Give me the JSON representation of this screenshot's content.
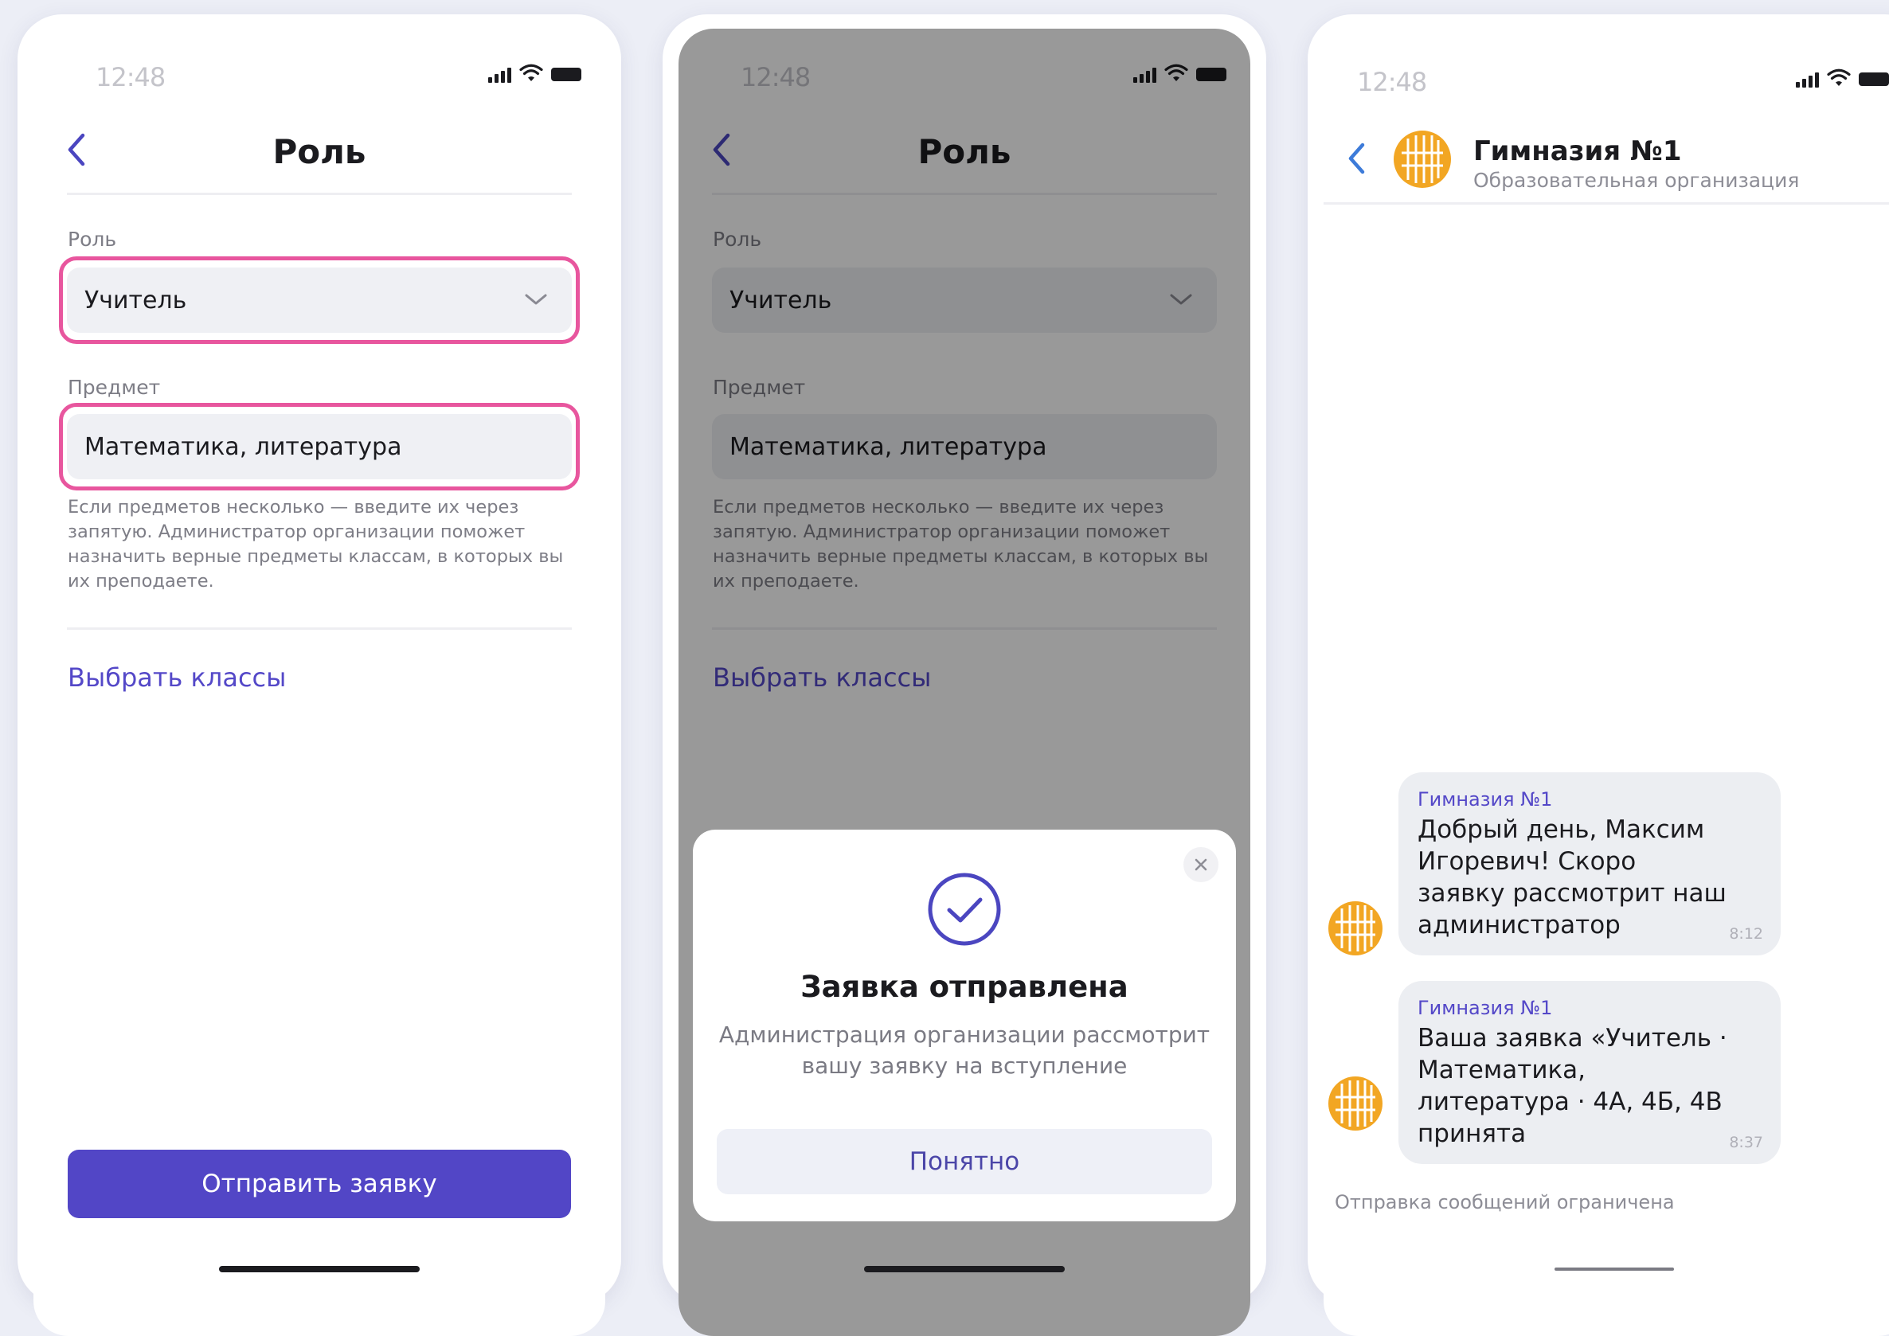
{
  "screens": [
    {
      "status_time": "12:48",
      "title": "Роль",
      "role_label": "Роль",
      "role_value": "Учитель",
      "subject_label": "Предмет",
      "subject_value": "Математика, литература",
      "hint": "Если предметов несколько — введите их через запятую. Администратор организации поможет назначить верные предметы классам, в которых вы их преподаете.",
      "choose_classes": "Выбрать классы",
      "submit": "Отправить заявку"
    },
    {
      "status_time": "12:48",
      "title": "Роль",
      "role_label": "Роль",
      "role_value": "Учитель",
      "subject_label": "Предмет",
      "subject_value": "Математика, литература",
      "hint": "Если предметов несколько — введите их через запятую. Администратор организации поможет назначить верные предметы классам, в которых вы их преподаете.",
      "choose_classes": "Выбрать классы",
      "modal": {
        "title": "Заявка отправлена",
        "text": "Администрация организации рассмотрит вашу заявку на вступление",
        "button": "Понятно"
      }
    },
    {
      "status_time": "12:48",
      "chat_name": "Гимназия №1",
      "chat_subtitle": "Образовательная организация",
      "messages": [
        {
          "sender": "Гимназия №1",
          "text": "Добрый день, Максим Игоревич! Скоро заявку рассмотрит наш администратор",
          "time": "8:12"
        },
        {
          "sender": "Гимназия №1",
          "text": "Ваша заявка «Учитель · Математика, литература · 4А, 4Б, 4В принята",
          "time": "8:37"
        }
      ],
      "composer_note": "Отправка сообщений ограничена"
    }
  ],
  "colors": {
    "accent": "#5246c6",
    "highlight": "#e8569e",
    "avatar": "#f2a623"
  }
}
